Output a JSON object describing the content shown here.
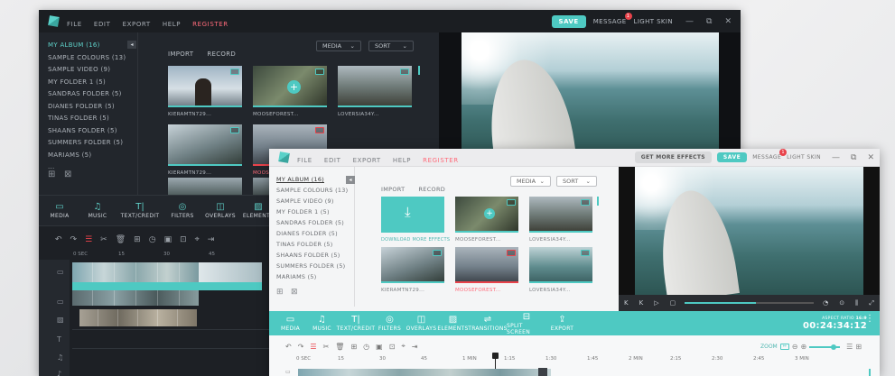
{
  "colors": {
    "accent": "#4ec9c2",
    "danger": "#e9434b",
    "register": "#ff6b7a"
  },
  "dark": {
    "menu": [
      "FILE",
      "EDIT",
      "EXPORT",
      "HELP"
    ],
    "register": "REGISTER",
    "save": "SAVE",
    "message": "MESSAGE",
    "badge": "1",
    "skin": "LIGHT SKIN",
    "win": [
      "—",
      "⧉",
      "✕"
    ],
    "sidebar": [
      "MY ALBUM (16)",
      "SAMPLE COLOURS (13)",
      "SAMPLE VIDEO (9)",
      "MY FOLDER 1 (5)",
      "SANDRAS FOLDER (5)",
      "DIANES FOLDER (5)",
      "TINAS FOLDER (5)",
      "SHAANS FOLDER (5)",
      "SUMMERS FOLDER  (5)",
      "MARIAMS (5)",
      "..."
    ],
    "tabs": [
      "IMPORT",
      "RECORD"
    ],
    "media_dd": "MEDIA",
    "sort_dd": "SORT",
    "thumbs": [
      "KIERAMTN729...",
      "MOOSEFOREST...",
      "LOVERSIA34Y...",
      "KIERAMTN729...",
      "MOOSEFOREST...",
      ""
    ],
    "tools": [
      {
        "icon": "▭",
        "label": "MEDIA"
      },
      {
        "icon": "♫",
        "label": "MUSIC"
      },
      {
        "icon": "T|",
        "label": "TEXT/CREDIT"
      },
      {
        "icon": "◎",
        "label": "FILTERS"
      },
      {
        "icon": "◫",
        "label": "OVERLAYS"
      },
      {
        "icon": "▨",
        "label": "ELEMENTS"
      }
    ],
    "edit_icons": [
      "↶",
      "↷",
      "☰",
      "✂",
      "🗑",
      "⊞",
      "◷",
      "▣",
      "⊡",
      "⌖",
      "⇥"
    ],
    "ruler": [
      "0 SEC",
      "15",
      "30",
      "45"
    ]
  },
  "light": {
    "menu": [
      "FILE",
      "EDIT",
      "EXPORT",
      "HELP"
    ],
    "register": "REGISTER",
    "effects": "GET MORE EFFECTS",
    "save": "SAVE",
    "message": "MESSAGE",
    "badge": "1",
    "skin": "LIGHT SKIN",
    "win": [
      "—",
      "⧉",
      "✕"
    ],
    "sidebar": [
      "MY ALBUM (16)",
      "SAMPLE COLOURS (13)",
      "SAMPLE VIDEO (9)",
      "MY FOLDER 1 (5)",
      "SANDRAS FOLDER (5)",
      "DIANES FOLDER (5)",
      "TINAS FOLDER (5)",
      "SHAANS FOLDER (5)",
      "SUMMERS FOLDER (5)",
      "MARIAMS (5)"
    ],
    "tabs": [
      "IMPORT",
      "RECORD"
    ],
    "media_dd": "MEDIA",
    "sort_dd": "SORT",
    "download_label": "DOWNLOAD MORE EFFECTS",
    "thumbs": [
      "MOOSEFOREST...",
      "LOVERSIA34Y...",
      "KIERAMTN729...",
      "MOOSEFOREST...",
      "LOVERSIA34Y..."
    ],
    "tools": [
      {
        "icon": "▭",
        "label": "MEDIA"
      },
      {
        "icon": "♫",
        "label": "MUSIC"
      },
      {
        "icon": "T|",
        "label": "TEXT/CREDIT"
      },
      {
        "icon": "◎",
        "label": "FILTERS"
      },
      {
        "icon": "◫",
        "label": "OVERLAYS"
      },
      {
        "icon": "▨",
        "label": "ELEMENTS"
      },
      {
        "icon": "⇌",
        "label": "TRANSITIONS"
      },
      {
        "icon": "⊟",
        "label": "SPLIT SCREEN"
      },
      {
        "icon": "⇪",
        "label": "EXPORT"
      }
    ],
    "aspect_label": "ASPECT RATIO",
    "aspect_value": "16:9",
    "timecode": "00:24:34:12",
    "zoom": "ZOOM",
    "edit_icons": [
      "↶",
      "↷",
      "☰",
      "✂",
      "🗑",
      "⊞",
      "◷",
      "▣",
      "⊡",
      "⌖",
      "⇥"
    ],
    "ruler": [
      "0 SEC",
      "15",
      "30",
      "45",
      "1 MIN",
      "1:15",
      "1:30",
      "1:45",
      "2 MIN",
      "2:15",
      "2:30",
      "2:45",
      "3 MIN"
    ],
    "playback": [
      "K",
      "K",
      "▷",
      "▢",
      "◔",
      "⊙",
      "⫼",
      "⤢"
    ]
  }
}
